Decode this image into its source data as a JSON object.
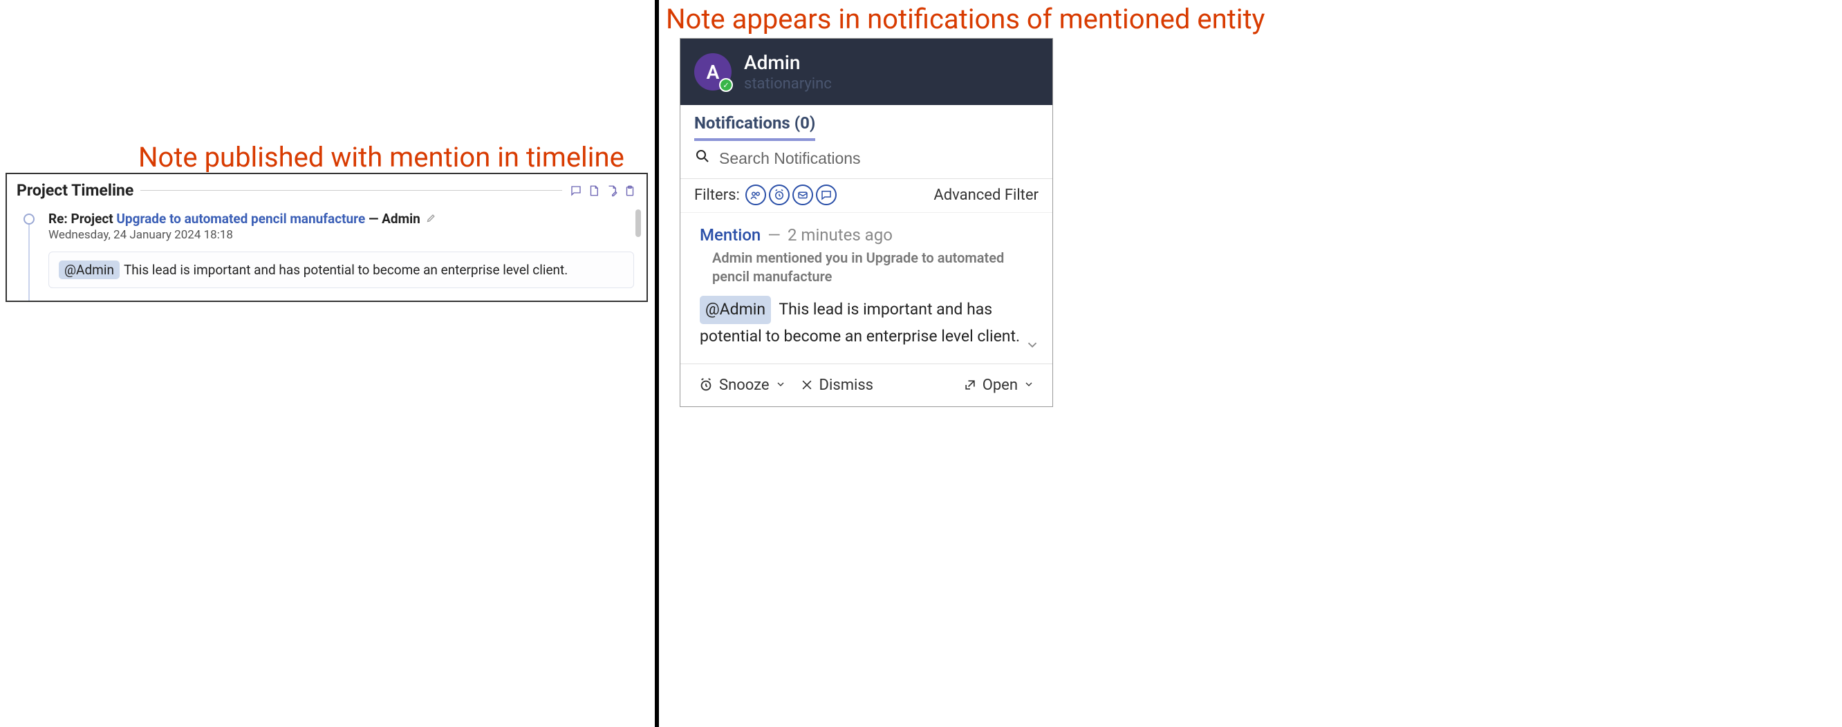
{
  "left": {
    "caption": "Note published with mention in timeline",
    "timeline_title": "Project Timeline",
    "entry": {
      "prefix": "Re: Project ",
      "link": "Upgrade to automated pencil manufacture",
      "dash": " — ",
      "author": "Admin",
      "date": "Wednesday, 24 January 2024 18:18",
      "mention": "@Admin",
      "note_text": "This lead is important and has potential to become an enterprise level client."
    }
  },
  "right": {
    "caption": "Note appears in notifications of mentioned entity",
    "header": {
      "avatar_initial": "A",
      "name": "Admin",
      "org": "stationaryinc"
    },
    "tabs": {
      "label": "Notifications (0)"
    },
    "search_placeholder": "Search Notifications",
    "filters_label": "Filters:",
    "advanced_filter": "Advanced Filter",
    "item": {
      "type": "Mention",
      "time": "2 minutes ago",
      "summary": "Admin mentioned you in Upgrade to automated pencil manufacture",
      "mention": "@Admin",
      "body": "This lead is important and has potential to become an enterprise level client."
    },
    "actions": {
      "snooze": "Snooze",
      "dismiss": "Dismiss",
      "open": "Open"
    }
  }
}
